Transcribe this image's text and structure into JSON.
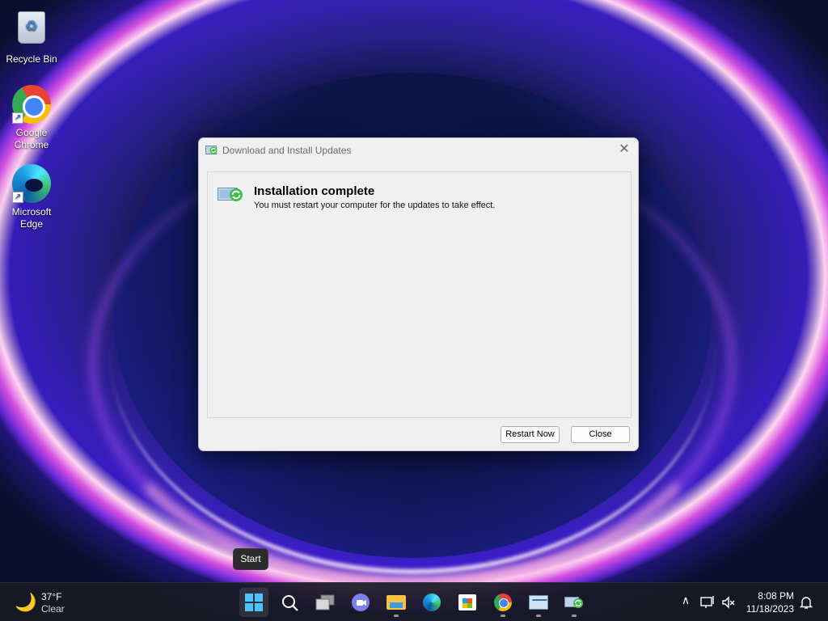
{
  "desktop": {
    "icons": [
      {
        "label": "Recycle Bin",
        "icon": "recycle-bin-icon"
      },
      {
        "label": "Google Chrome",
        "icon": "chrome-icon"
      },
      {
        "label": "Microsoft Edge",
        "icon": "edge-icon"
      }
    ]
  },
  "dialog": {
    "title": "Download and Install Updates",
    "heading": "Installation complete",
    "message": "You must restart your computer for the updates to take effect.",
    "restart_label": "Restart Now",
    "close_label": "Close",
    "close_glyph": "✕"
  },
  "tooltip": {
    "text": "Start"
  },
  "taskbar": {
    "weather": {
      "temp": "37°F",
      "condition": "Clear"
    },
    "apps": [
      {
        "name": "start-icon"
      },
      {
        "name": "search-icon"
      },
      {
        "name": "task-view-icon"
      },
      {
        "name": "teams-chat-icon"
      },
      {
        "name": "file-explorer-icon"
      },
      {
        "name": "edge-icon"
      },
      {
        "name": "store-icon"
      },
      {
        "name": "chrome-icon"
      },
      {
        "name": "performance-monitor-icon"
      },
      {
        "name": "windows-update-icon"
      }
    ],
    "tray": {
      "chevron": "∧",
      "time": "8:08 PM",
      "date": "11/18/2023"
    }
  },
  "colors": {
    "accent": "#4cc2ff",
    "taskbar": "#181a24",
    "dialog_bg": "#f0f0f0"
  }
}
